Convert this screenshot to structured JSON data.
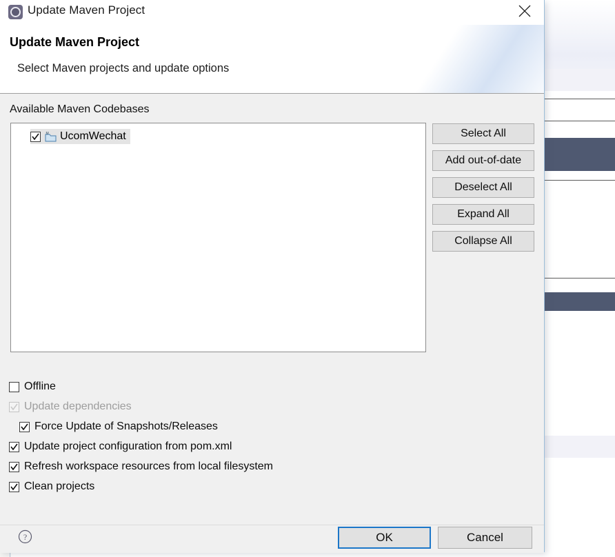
{
  "window": {
    "title": "Update Maven Project",
    "icon": "maven-gear-icon",
    "close_label": "✕"
  },
  "header": {
    "title": "Update Maven Project",
    "subtitle": "Select Maven projects and update options"
  },
  "body": {
    "codebases_label": "Available Maven Codebases",
    "tree": {
      "items": [
        {
          "label": "UcomWechat",
          "checked": true,
          "selected": true,
          "icon": "maven-project-icon"
        }
      ]
    },
    "side_buttons": [
      {
        "label": "Select All"
      },
      {
        "label": "Add out-of-date"
      },
      {
        "label": "Deselect All"
      },
      {
        "label": "Expand All"
      },
      {
        "label": "Collapse All"
      }
    ],
    "options": [
      {
        "label": "Offline",
        "checked": false,
        "enabled": true,
        "indent": 0
      },
      {
        "label": "Update dependencies",
        "checked": true,
        "enabled": false,
        "indent": 0
      },
      {
        "label": "Force Update of Snapshots/Releases",
        "checked": true,
        "enabled": true,
        "indent": 1
      },
      {
        "label": "Update project configuration from pom.xml",
        "checked": true,
        "enabled": true,
        "indent": 0
      },
      {
        "label": "Refresh workspace resources from local filesystem",
        "checked": true,
        "enabled": true,
        "indent": 0
      },
      {
        "label": "Clean projects",
        "checked": true,
        "enabled": true,
        "indent": 0
      }
    ]
  },
  "footer": {
    "help_icon": "help-question-icon",
    "ok_label": "OK",
    "cancel_label": "Cancel"
  },
  "colors": {
    "dialog_background": "#f0f0f0",
    "dialog_border": "#9bbdd9",
    "header_background": "#ffffff",
    "button_face": "#e1e1e1",
    "button_border": "#adadad",
    "default_button_focus": "#1b76c8",
    "tree_selection": "#e4e4e4",
    "disabled_text": "#9d9d9d",
    "backdrop_band": "#4f5971"
  }
}
